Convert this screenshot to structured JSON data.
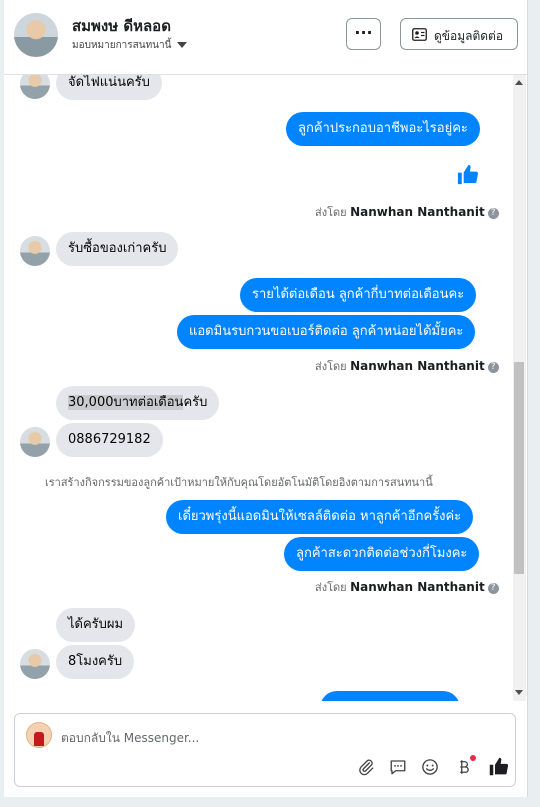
{
  "header": {
    "name": "สมพงษ ดีหลอด",
    "subtitle": "มอบหมายการสนทนานี้",
    "more_label": "···",
    "contact_label": "ดูข้อมูลติดต่อ"
  },
  "messages": {
    "m1": "จัดไฟแน่นครับ",
    "m2": "ลูกค้าประกอบอาชีพอะไรอยู่คะ",
    "sent_prefix": "ส่งโดย",
    "sent_name": "Nanwhan Nanthanit",
    "m3": "รับซื้อของเก่าครับ",
    "m4": "รายได้ต่อเดือน ลูกค้ากี่บาทต่อเดือนคะ",
    "m5": "แอดมินรบกวนขอเบอร์ติดต่อ ลูกค้าหน่อยได้มั้ยคะ",
    "m6_highlight": "30,000บาทต่อเดือน",
    "m6_rest": "ครับ",
    "m7": "0886729182",
    "system_note": "เราสร้างกิจกรรมของลูกค้าเป้าหมายให้กับคุณโดยอัตโนมัติโดยอิงตามการสนทนานี้",
    "m8": "เดี๋ยวพรุ่งนี้แอดมินให้เซลล์ติดต่อ หาลูกค้าอีกครั้งค่ะ",
    "m9": "ลูกค้าสะดวกติดต่อช่วงกี่โมงคะ",
    "m10": "ได้ครับผม",
    "m11": "8โมงครับ"
  },
  "composer": {
    "placeholder": "ตอบกลับใน Messenger..."
  },
  "icons": [
    "like-icon",
    "info-icon",
    "paperclip-icon",
    "saved-reply-icon",
    "emoji-icon",
    "baht-icon",
    "thumbs-up-icon",
    "contact-card-icon"
  ],
  "colors": {
    "outgoing": "#0084ff",
    "incoming": "#e4e6eb",
    "notification": "#f02849"
  }
}
